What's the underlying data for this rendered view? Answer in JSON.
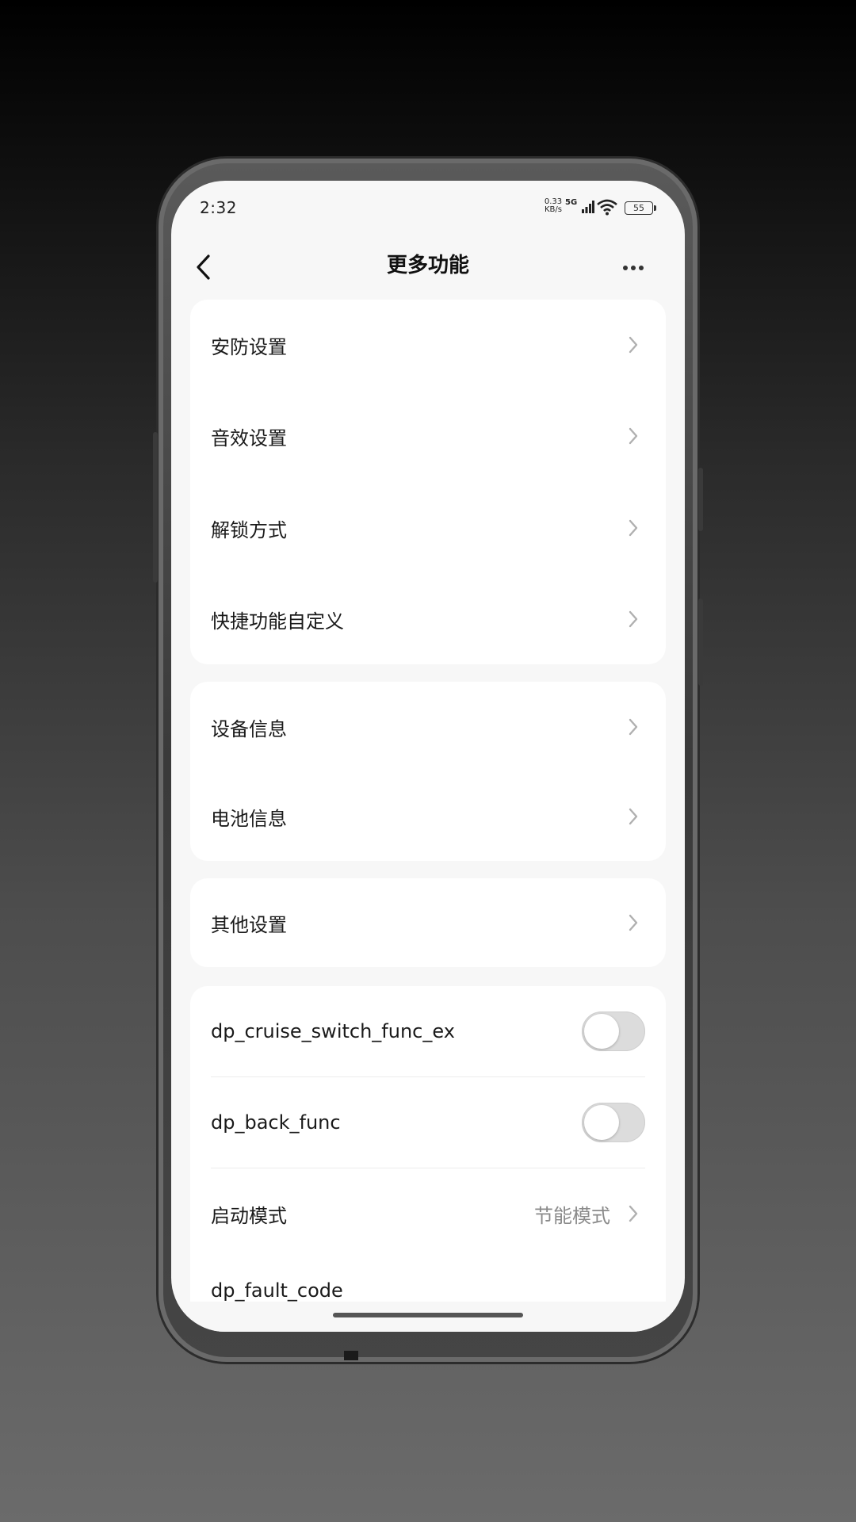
{
  "status_bar": {
    "time": "2:32",
    "net_speed_value": "0.33",
    "net_speed_unit": "KB/s",
    "network_type": "5G",
    "battery": "55"
  },
  "header": {
    "title": "更多功能",
    "back_icon": "chevron-left-icon",
    "more_icon": "more-dots-icon"
  },
  "groups": [
    {
      "items": [
        {
          "label": "安防设置"
        },
        {
          "label": "音效设置"
        },
        {
          "label": "解锁方式"
        },
        {
          "label": "快捷功能自定义"
        }
      ]
    },
    {
      "items": [
        {
          "label": "设备信息"
        },
        {
          "label": "电池信息"
        }
      ]
    },
    {
      "items": [
        {
          "label": "其他设置"
        }
      ]
    },
    {
      "items": [
        {
          "label": "dp_cruise_switch_func_ex",
          "toggle": false
        },
        {
          "label": "dp_back_func",
          "toggle": false
        },
        {
          "label": "启动模式",
          "value": "节能模式"
        },
        {
          "label": "dp_fault_code"
        }
      ]
    }
  ],
  "colors": {
    "page_background": "#f7f7f7",
    "card_background": "#ffffff",
    "toggle_off": "#dcdcdc"
  }
}
